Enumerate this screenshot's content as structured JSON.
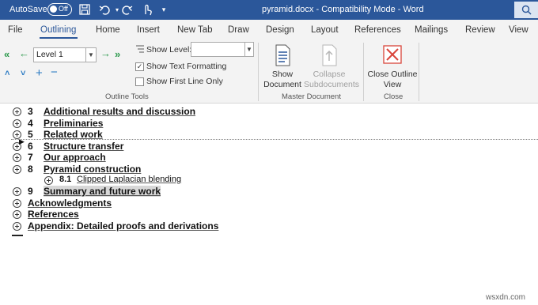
{
  "titlebar": {
    "autosave": "AutoSave",
    "autosave_state": "Off",
    "doc_title": "pyramid.docx  -  Compatibility Mode  -  Word",
    "icons": [
      "save-icon",
      "undo-icon",
      "redo-icon",
      "touch-mode-icon",
      "customize-qat-icon",
      "search-icon"
    ]
  },
  "ribbon_tabs": [
    "File",
    "Outlining",
    "Home",
    "Insert",
    "New Tab",
    "Draw",
    "Design",
    "Layout",
    "References",
    "Mailings",
    "Review",
    "View"
  ],
  "active_tab": "Outlining",
  "outline_tools": {
    "level_value": "Level 1",
    "show_level_label": "Show Level:",
    "show_level_value": "",
    "show_text_formatting": "Show Text Formatting",
    "show_text_formatting_checked": true,
    "show_first_line_only": "Show First Line Only",
    "show_first_line_only_checked": false,
    "group_label": "Outline Tools"
  },
  "master_document": {
    "show_document": "Show Document",
    "collapse_subdocuments": "Collapse Subdocuments",
    "group_label": "Master Document"
  },
  "close_group": {
    "close_outline_view": "Close Outline View",
    "group_label": "Close"
  },
  "outline": [
    {
      "num": "3",
      "text": "Additional results and discussion"
    },
    {
      "num": "4",
      "text": "Preliminaries"
    },
    {
      "num": "5",
      "text": "Related work"
    },
    {
      "num": "6",
      "text": "Structure transfer"
    },
    {
      "num": "7",
      "text": "Our approach"
    },
    {
      "num": "8",
      "text": "Pyramid construction"
    },
    {
      "num": "8.1",
      "text": "Clipped Laplacian blending"
    },
    {
      "num": "9",
      "text": "Summary and future work"
    },
    {
      "num": "",
      "text": "Acknowledgments"
    },
    {
      "num": "",
      "text": "References"
    },
    {
      "num": "",
      "text": "Appendix: Detailed proofs and derivations"
    }
  ],
  "watermark": "wsxdn.com",
  "colors": {
    "accent": "#2b579a",
    "promote_arrow": "#2e9a4e",
    "move_arrow": "#2b7bc3",
    "close_icon": "#d9453b"
  }
}
